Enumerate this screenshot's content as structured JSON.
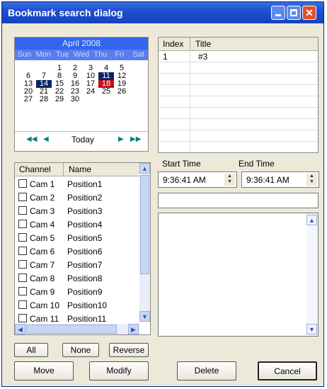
{
  "window": {
    "title": "Bookmark search dialog",
    "close_glyph": "✕"
  },
  "calendar": {
    "month_label": "April 2008",
    "day_names": [
      "Sun",
      "Mon",
      "Tue",
      "Wed",
      "Thu",
      "Fri",
      "Sat"
    ],
    "weeks": [
      [
        "",
        "",
        "1",
        "2",
        "3",
        "4",
        "5"
      ],
      [
        "6",
        "7",
        "8",
        "9",
        "10",
        "11",
        "12"
      ],
      [
        "13",
        "14",
        "15",
        "16",
        "17",
        "18",
        "19"
      ],
      [
        "20",
        "21",
        "22",
        "23",
        "24",
        "25",
        "26"
      ],
      [
        "27",
        "28",
        "29",
        "30",
        "",
        "",
        ""
      ]
    ],
    "selected_days": [
      "11",
      "14"
    ],
    "today_day": "18",
    "today_label": "Today",
    "nav_first_glyph": "◀◀",
    "nav_prev_glyph": "◀",
    "nav_next_glyph": "▶",
    "nav_last_glyph": "▶▶"
  },
  "channels": {
    "headers": {
      "channel": "Channel",
      "name": "Name"
    },
    "rows": [
      {
        "channel": "Cam 1",
        "name": "Position1"
      },
      {
        "channel": "Cam 2",
        "name": "Position2"
      },
      {
        "channel": "Cam 3",
        "name": "Position3"
      },
      {
        "channel": "Cam 4",
        "name": "Position4"
      },
      {
        "channel": "Cam 5",
        "name": "Position5"
      },
      {
        "channel": "Cam 6",
        "name": "Position6"
      },
      {
        "channel": "Cam 7",
        "name": "Position7"
      },
      {
        "channel": "Cam 8",
        "name": "Position8"
      },
      {
        "channel": "Cam 9",
        "name": "Position9"
      },
      {
        "channel": "Cam 10",
        "name": "Position10"
      },
      {
        "channel": "Cam 11",
        "name": "Position11"
      }
    ],
    "scroll_up_glyph": "▲",
    "scroll_down_glyph": "▼",
    "scroll_left_glyph": "◀",
    "scroll_right_glyph": "▶"
  },
  "selection_buttons": {
    "all": "All",
    "none": "None",
    "reverse": "Reverse"
  },
  "bookmarks": {
    "headers": {
      "index": "Index",
      "title": "Title"
    },
    "rows": [
      {
        "index": "1",
        "title": "#3"
      }
    ]
  },
  "time": {
    "start_label": "Start Time",
    "end_label": "End Time",
    "start_value": "9:36:41 AM",
    "end_value": "9:36:41 AM",
    "spin_up_glyph": "▲",
    "spin_down_glyph": "▼"
  },
  "notes": {
    "scroll_up_glyph": "▲",
    "scroll_down_glyph": "▼"
  },
  "actions": {
    "move": "Move",
    "modify": "Modify",
    "delete": "Delete",
    "cancel": "Cancel"
  }
}
